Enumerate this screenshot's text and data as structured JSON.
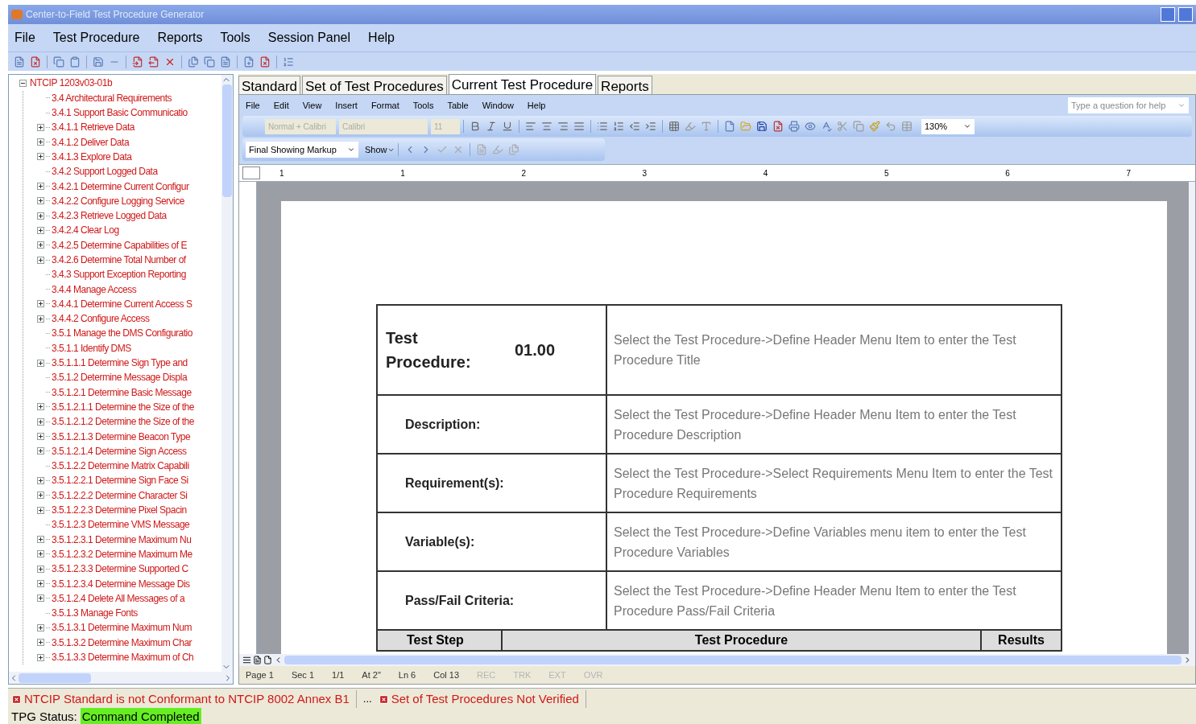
{
  "window": {
    "title": "Center-to-Field Test Procedure Generator"
  },
  "menu": [
    "File",
    "Test Procedure",
    "Reports",
    "Tools",
    "Session Panel",
    "Help"
  ],
  "tree": {
    "label": "NTCIP 1203v03-01b",
    "expanded": true,
    "children": [
      {
        "label": "3.4 Architectural Requirements",
        "kind": "leaf"
      },
      {
        "label": "3.4.1 Support Basic Communicatio",
        "kind": "leaf"
      },
      {
        "label": "3.4.1.1 Retrieve Data",
        "kind": "group",
        "expanded": false
      },
      {
        "label": "3.4.1.2 Deliver Data",
        "kind": "group",
        "expanded": false
      },
      {
        "label": "3.4.1.3 Explore Data",
        "kind": "group",
        "expanded": false
      },
      {
        "label": "3.4.2 Support Logged Data",
        "kind": "leaf"
      },
      {
        "label": "3.4.2.1 Determine Current Configur",
        "kind": "group",
        "expanded": false
      },
      {
        "label": "3.4.2.2 Configure Logging Service",
        "kind": "group",
        "expanded": false
      },
      {
        "label": "3.4.2.3 Retrieve Logged Data",
        "kind": "group",
        "expanded": false
      },
      {
        "label": "3.4.2.4 Clear Log",
        "kind": "group",
        "expanded": false
      },
      {
        "label": "3.4.2.5 Determine Capabilities of E",
        "kind": "group",
        "expanded": false
      },
      {
        "label": "3.4.2.6 Determine Total Number of",
        "kind": "group",
        "expanded": false
      },
      {
        "label": "3.4.3 Support Exception Reporting",
        "kind": "leaf"
      },
      {
        "label": "3.4.4 Manage Access",
        "kind": "leaf"
      },
      {
        "label": "3.4.4.1 Determine Current Access S",
        "kind": "group",
        "expanded": false
      },
      {
        "label": "3.4.4.2 Configure Access",
        "kind": "group",
        "expanded": false
      },
      {
        "label": "3.5.1 Manage the DMS Configuratio",
        "kind": "leaf"
      },
      {
        "label": "3.5.1.1 Identify DMS",
        "kind": "leaf"
      },
      {
        "label": "3.5.1.1.1 Determine Sign Type and",
        "kind": "group",
        "expanded": false
      },
      {
        "label": "3.5.1.2 Determine Message Displa",
        "kind": "leaf"
      },
      {
        "label": "3.5.1.2.1 Determine Basic Message",
        "kind": "leaf"
      },
      {
        "label": "3.5.1.2.1.1 Determine the Size of the",
        "kind": "group",
        "expanded": false
      },
      {
        "label": "3.5.1.2.1.2 Determine the Size of the",
        "kind": "group",
        "expanded": false
      },
      {
        "label": "3.5.1.2.1.3 Determine Beacon Type",
        "kind": "group",
        "expanded": false
      },
      {
        "label": "3.5.1.2.1.4 Determine Sign Access",
        "kind": "group",
        "expanded": false
      },
      {
        "label": "3.5.1.2.2 Determine Matrix Capabili",
        "kind": "leaf"
      },
      {
        "label": "3.5.1.2.2.1 Determine Sign Face Si",
        "kind": "group",
        "expanded": false
      },
      {
        "label": "3.5.1.2.2.2 Determine Character Si",
        "kind": "group",
        "expanded": false
      },
      {
        "label": "3.5.1.2.2.3 Determine Pixel Spacin",
        "kind": "group",
        "expanded": false
      },
      {
        "label": "3.5.1.2.3 Determine VMS Message",
        "kind": "leaf"
      },
      {
        "label": "3.5.1.2.3.1 Determine Maximum Nu",
        "kind": "group",
        "expanded": false
      },
      {
        "label": "3.5.1.2.3.2 Determine Maximum Me",
        "kind": "group",
        "expanded": false
      },
      {
        "label": "3.5.1.2.3.3 Determine Supported C",
        "kind": "group",
        "expanded": false
      },
      {
        "label": "3.5.1.2.3.4 Determine Message Dis",
        "kind": "group",
        "expanded": false
      },
      {
        "label": "3.5.1.2.4 Delete All Messages of a",
        "kind": "group",
        "expanded": false
      },
      {
        "label": "3.5.1.3 Manage Fonts",
        "kind": "leaf"
      },
      {
        "label": "3.5.1.3.1 Determine Maximum Num",
        "kind": "group",
        "expanded": false
      },
      {
        "label": "3.5.1.3.2 Determine Maximum Char",
        "kind": "group",
        "expanded": false
      },
      {
        "label": "3.5.1.3.3 Determine Maximum of Ch",
        "kind": "group",
        "expanded": false
      }
    ]
  },
  "tabs": [
    {
      "label": "Standard",
      "selected": false
    },
    {
      "label": "Set of Test Procedures",
      "selected": false
    },
    {
      "label": "Current Test Procedure",
      "selected": true
    },
    {
      "label": "Reports",
      "selected": false
    }
  ],
  "word": {
    "menu": [
      "File",
      "Edit",
      "View",
      "Insert",
      "Format",
      "Tools",
      "Table",
      "Window",
      "Help"
    ],
    "help_field": {
      "placeholder": "Type a question for help"
    },
    "style_box": "Normal + Calibri",
    "font_box": "Calibri",
    "size_box": "11",
    "zoom_box": "130%",
    "markup_box": "Final Showing Markup",
    "show_menu": "Show",
    "ruler": [
      "1",
      "1",
      "2",
      "3",
      "4",
      "5",
      "6",
      "7"
    ],
    "document": {
      "title_label": "Test Procedure:",
      "number": "01.00",
      "title_hint": "Select the Test Procedure->Define Header Menu Item to enter the Test Procedure Title",
      "rows": [
        {
          "label": "Description:",
          "hint": "Select the Test Procedure->Define Header Menu Item to enter the Test Procedure Description"
        },
        {
          "label": "Requirement(s):",
          "hint": "Select the Test Procedure->Select Requirements Menu Item to enter the Test Procedure Requirements"
        },
        {
          "label": "Variable(s):",
          "hint": "Select the Test Procedure->Define Variables menu item to enter the Test Procedure Variables"
        },
        {
          "label": "Pass/Fail Criteria:",
          "hint": "Select the Test Procedure->Define Header Menu Item to enter the Test Procedure Pass/Fail Criteria"
        }
      ],
      "step_headers": [
        "Test Step",
        "Test Procedure",
        "Results"
      ]
    },
    "status": [
      {
        "text": "Page 1",
        "disabled": false
      },
      {
        "text": "Sec 1",
        "disabled": false
      },
      {
        "text": "1/1",
        "disabled": false
      },
      {
        "text": "At 2\"",
        "disabled": false
      },
      {
        "text": "Ln 6",
        "disabled": false
      },
      {
        "text": "Col 13",
        "disabled": false
      },
      {
        "text": "REC",
        "disabled": true
      },
      {
        "text": "TRK",
        "disabled": true
      },
      {
        "text": "EXT",
        "disabled": true
      },
      {
        "text": "OVR",
        "disabled": true
      }
    ]
  },
  "errors": [
    {
      "kind": "error",
      "text": "NTCIP Standard is not Conformant to NTCIP 8002 Annex B1"
    },
    {
      "kind": "more",
      "text": "..."
    },
    {
      "kind": "error",
      "text": "Set of Test Procedures Not Verified"
    }
  ],
  "tpg_status": {
    "label": "TPG Status:",
    "value": "Command Completed"
  }
}
